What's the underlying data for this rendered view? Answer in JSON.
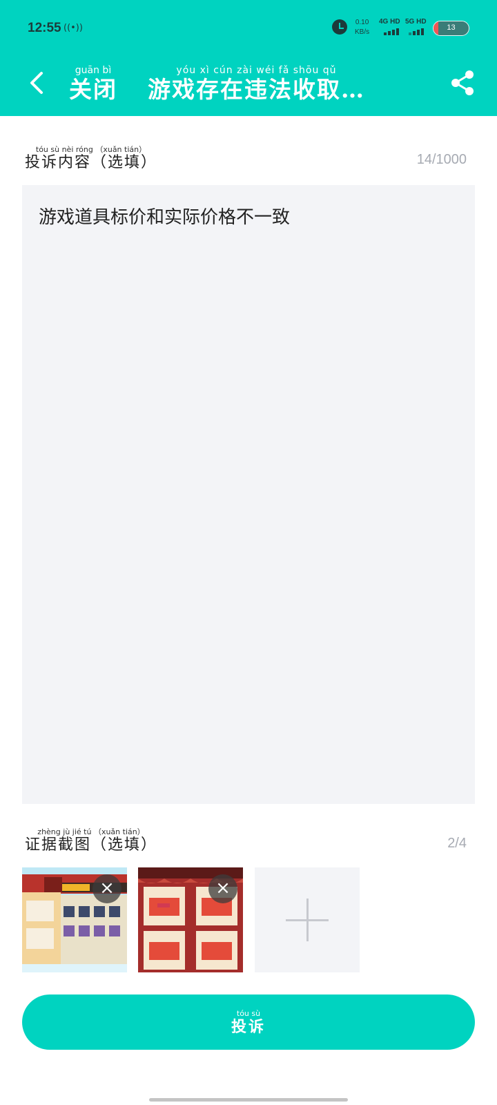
{
  "status_bar": {
    "time": "12:55",
    "net_speed_value": "0.10",
    "net_speed_unit": "KB/s",
    "signal_1": "4G HD",
    "signal_2": "5G HD",
    "battery": "13",
    "battery_level_percent": 13
  },
  "header": {
    "close_pinyin": "guān bì",
    "close_label": "关闭",
    "title_pinyin": "yóu xì cún zài wéi fǎ shōu qǔ",
    "title": "游戏存在违法收取…",
    "background_color": "#00d3c0"
  },
  "content_section": {
    "label_pinyin": "tóu sù nèi róng （xuǎn tián）",
    "label": "投诉内容（选填）",
    "counter": "14/1000",
    "text": "游戏道具标价和实际价格不一致"
  },
  "evidence_section": {
    "label_pinyin": "zhèng jù jié tú （xuǎn tián）",
    "label": "证据截图（选填）",
    "counter": "2/4",
    "remove_icon": "×"
  },
  "submit": {
    "pinyin": "tóu sù",
    "label": "投诉"
  }
}
